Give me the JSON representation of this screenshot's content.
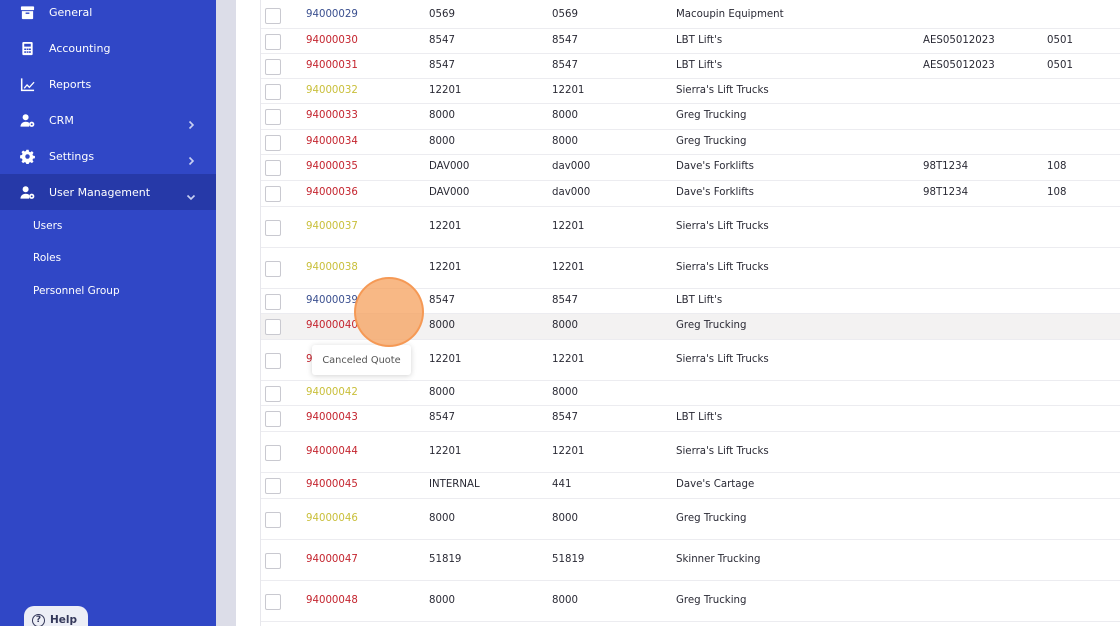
{
  "sidebar": {
    "items": [
      {
        "label": "General",
        "icon": "archive-icon"
      },
      {
        "label": "Accounting",
        "icon": "calculator-icon"
      },
      {
        "label": "Reports",
        "icon": "chart-line-icon"
      },
      {
        "label": "CRM",
        "icon": "users-cog-icon"
      },
      {
        "label": "Settings",
        "icon": "gear-icon"
      },
      {
        "label": "User Management",
        "icon": "user-cog-icon"
      }
    ],
    "subitems": [
      {
        "label": "Users"
      },
      {
        "label": "Roles"
      },
      {
        "label": "Personnel Group"
      }
    ],
    "help_label": "Help",
    "help_icon_glyph": "?"
  },
  "table": {
    "rows": [
      {
        "id": "94000029",
        "status": "blue",
        "c1": "0569",
        "c2": "0569",
        "c3": "Macoupin Equipment",
        "c4": "",
        "c5": ""
      },
      {
        "id": "94000030",
        "status": "red",
        "c1": "8547",
        "c2": "8547",
        "c3": "LBT Lift's",
        "c4": "AES05012023",
        "c5": "0501"
      },
      {
        "id": "94000031",
        "status": "red",
        "c1": "8547",
        "c2": "8547",
        "c3": "LBT Lift's",
        "c4": "AES05012023",
        "c5": "0501"
      },
      {
        "id": "94000032",
        "status": "yellow",
        "c1": "12201",
        "c2": "12201",
        "c3": "Sierra's Lift Trucks",
        "c4": "",
        "c5": ""
      },
      {
        "id": "94000033",
        "status": "red",
        "c1": "8000",
        "c2": "8000",
        "c3": "Greg Trucking",
        "c4": "",
        "c5": ""
      },
      {
        "id": "94000034",
        "status": "red",
        "c1": "8000",
        "c2": "8000",
        "c3": "Greg Trucking",
        "c4": "",
        "c5": ""
      },
      {
        "id": "94000035",
        "status": "red",
        "c1": "DAV000",
        "c2": "dav000",
        "c3": "Dave's Forklifts",
        "c4": "98T1234",
        "c5": "108"
      },
      {
        "id": "94000036",
        "status": "red",
        "c1": "DAV000",
        "c2": "dav000",
        "c3": "Dave's Forklifts",
        "c4": "98T1234",
        "c5": "108"
      },
      {
        "id": "94000037",
        "status": "yellow",
        "c1": "12201",
        "c2": "12201",
        "c3": "Sierra's Lift Trucks",
        "c4": "",
        "c5": ""
      },
      {
        "id": "94000038",
        "status": "yellow",
        "c1": "12201",
        "c2": "12201",
        "c3": "Sierra's Lift Trucks",
        "c4": "",
        "c5": ""
      },
      {
        "id": "94000039",
        "status": "blue",
        "c1": "8547",
        "c2": "8547",
        "c3": "LBT Lift's",
        "c4": "",
        "c5": ""
      },
      {
        "id": "94000040",
        "status": "red",
        "c1": "8000",
        "c2": "8000",
        "c3": "Greg Trucking",
        "c4": "",
        "c5": ""
      },
      {
        "id": "94000041",
        "status": "red",
        "c1": "12201",
        "c2": "12201",
        "c3": "Sierra's Lift Trucks",
        "c4": "",
        "c5": ""
      },
      {
        "id": "94000042",
        "status": "yellow",
        "c1": "8000",
        "c2": "8000",
        "c3": "",
        "c4": "",
        "c5": ""
      },
      {
        "id": "94000043",
        "status": "red",
        "c1": "8547",
        "c2": "8547",
        "c3": "LBT Lift's",
        "c4": "",
        "c5": ""
      },
      {
        "id": "94000044",
        "status": "red",
        "c1": "12201",
        "c2": "12201",
        "c3": "Sierra's Lift Trucks",
        "c4": "",
        "c5": ""
      },
      {
        "id": "94000045",
        "status": "red",
        "c1": "INTERNAL",
        "c2": "441",
        "c3": "Dave's Cartage",
        "c4": "",
        "c5": ""
      },
      {
        "id": "94000046",
        "status": "yellow",
        "c1": "8000",
        "c2": "8000",
        "c3": "Greg Trucking",
        "c4": "",
        "c5": ""
      },
      {
        "id": "94000047",
        "status": "red",
        "c1": "51819",
        "c2": "51819",
        "c3": "Skinner Trucking",
        "c4": "",
        "c5": ""
      },
      {
        "id": "94000048",
        "status": "red",
        "c1": "8000",
        "c2": "8000",
        "c3": "Greg Trucking",
        "c4": "",
        "c5": ""
      }
    ],
    "tooltip": "Canceled Quote",
    "status_colors": {
      "blue": "#3a4f8f",
      "red": "#c4242e",
      "yellow": "#c9bf3a"
    }
  }
}
